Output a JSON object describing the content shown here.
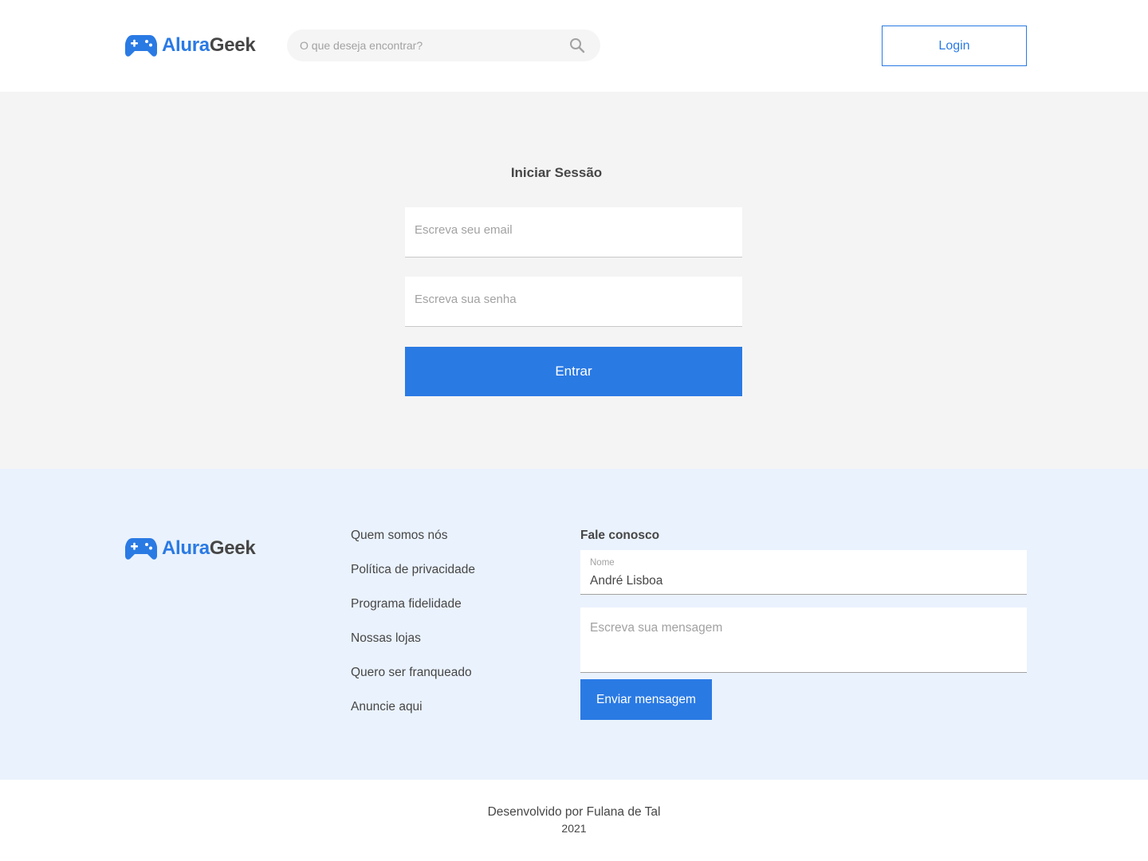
{
  "brand": {
    "name_part1": "Alura",
    "name_part2": "Geek",
    "icon": "gamepad-icon",
    "primary_color": "#2A7AE4",
    "text_color": "#464646"
  },
  "header": {
    "search_placeholder": "O que deseja encontrar?",
    "search_icon": "search-icon",
    "login_label": "Login"
  },
  "login": {
    "title": "Iniciar Sessão",
    "email_placeholder": "Escreva seu email",
    "password_placeholder": "Escreva sua senha",
    "submit_label": "Entrar"
  },
  "footer": {
    "links": [
      "Quem somos nós",
      "Política de privacidade",
      "Programa fidelidade",
      "Nossas lojas",
      "Quero ser franqueado",
      "Anuncie aqui"
    ],
    "contact": {
      "title": "Fale conosco",
      "name_label": "Nome",
      "name_value": "André Lisboa",
      "message_placeholder": "Escreva sua mensagem",
      "send_label": "Enviar mensagem"
    },
    "bg_color": "#EAF2FD"
  },
  "credits": {
    "developed_by": "Desenvolvido por Fulana de Tal",
    "year": "2021"
  }
}
